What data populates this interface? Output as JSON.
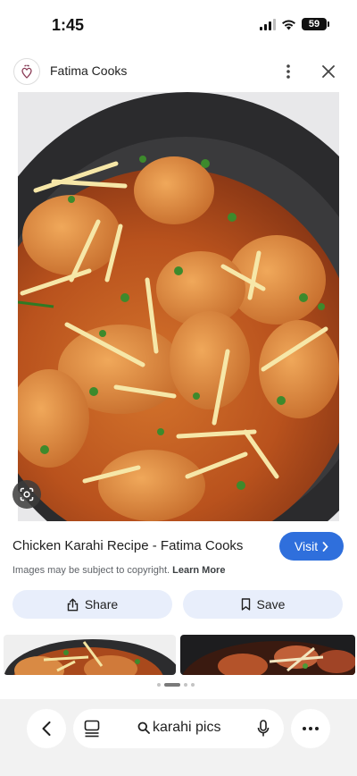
{
  "status_bar": {
    "time": "1:45",
    "battery": "59"
  },
  "header": {
    "site_name": "Fatima Cooks",
    "logo_icon": "heart-leaves-logo-icon",
    "more_icon": "more-vertical-icon",
    "close_icon": "close-icon"
  },
  "main_image": {
    "alt": "Chicken karahi in a dark iron pan garnished with ginger and cilantro",
    "lens_icon": "google-lens-icon"
  },
  "result": {
    "title": "Chicken Karahi Recipe - Fatima Cooks",
    "visit_label": "Visit",
    "copyright_text": "Images may be subject to copyright.",
    "learn_more": "Learn More"
  },
  "actions": {
    "share_label": "Share",
    "save_label": "Save"
  },
  "search_bar": {
    "query": "karahi pics"
  },
  "colors": {
    "accent": "#2f6fdc",
    "action_bg": "#e8eefb",
    "bottom_bar_bg": "#f2f2f2"
  }
}
